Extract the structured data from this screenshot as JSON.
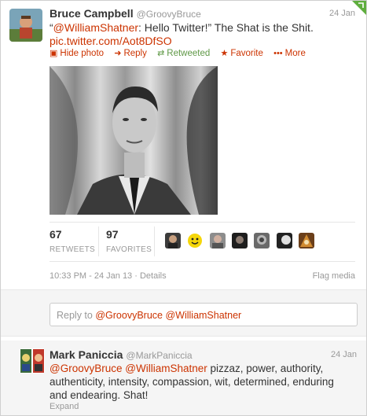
{
  "tweet": {
    "fullname": "Bruce Campbell",
    "username": "@GroovyBruce",
    "time": "24 Jan",
    "text_prefix": "“",
    "text_mention": "@WilliamShatner",
    "text_body": ": Hello Twitter!” The Shat is the Shit.",
    "link": "pic.twitter.com/Aot8DfSO",
    "actions": {
      "hide_photo": "Hide photo",
      "reply": "Reply",
      "retweeted": "Retweeted",
      "favorite": "Favorite",
      "more": "More"
    },
    "stats": {
      "retweets_count": "67",
      "retweets_label": "RETWEETS",
      "favorites_count": "97",
      "favorites_label": "FAVORITES"
    },
    "timestamp": "10:33 PM - 24 Jan 13",
    "separator": "·",
    "details": "Details",
    "flag_media": "Flag media"
  },
  "reply_box": {
    "placeholder": "Reply to",
    "mention1": "@GroovyBruce",
    "mention2": "@WilliamShatner"
  },
  "reply": {
    "fullname": "Mark Paniccia",
    "username": "@MarkPaniccia",
    "time": "24 Jan",
    "mention1": "@GroovyBruce",
    "mention2": "@WilliamShatner",
    "body": " pizzaz, power, authority, authenticity, intensity, compassion, wit, determined, enduring and endearing. Shat!",
    "expand": "Expand"
  },
  "colors": {
    "link": "#cc3300",
    "retweeted": "#5f9846",
    "muted": "#999999",
    "text": "#333333"
  },
  "icons": [
    "photo-icon",
    "reply-icon",
    "retweet-icon",
    "star-icon",
    "more-icon",
    "corner-flag-icon"
  ]
}
